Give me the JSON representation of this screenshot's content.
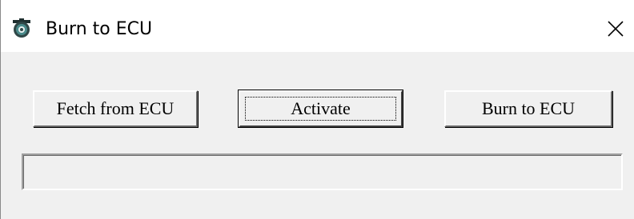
{
  "window": {
    "title": "Burn to ECU",
    "app_icon": "ecu-app-icon",
    "close_icon": "close-icon"
  },
  "buttons": {
    "fetch_label": "Fetch from ECU",
    "activate_label": "Activate",
    "burn_label": "Burn to ECU"
  },
  "progress": {
    "value": 0
  },
  "colors": {
    "background": "#f0f0f0",
    "titlebar": "#ffffff",
    "icon_teal": "#2e6b6b"
  }
}
